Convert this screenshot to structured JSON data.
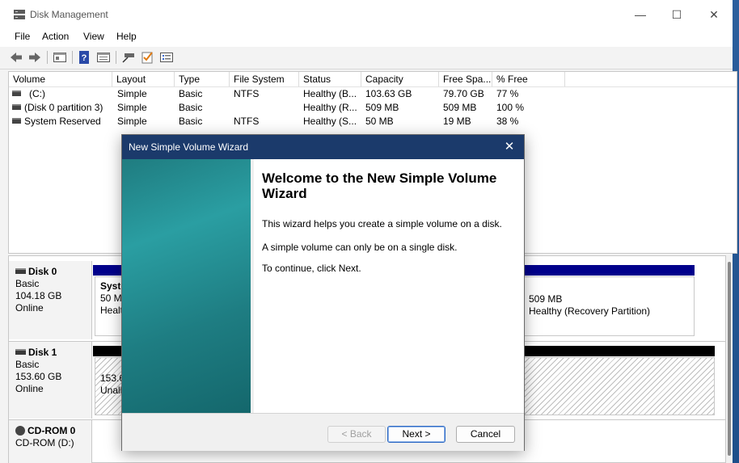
{
  "window": {
    "title": "Disk Management",
    "controls": {
      "minimize": "—",
      "maximize": "☐",
      "close": "✕"
    }
  },
  "menu": [
    "File",
    "Action",
    "View",
    "Help"
  ],
  "toolbar": {
    "icons": [
      "back-arrow-icon",
      "forward-arrow-icon",
      "console-tree-icon",
      "help-icon",
      "properties-icon",
      "connect-icon",
      "check-icon",
      "list-view-icon"
    ]
  },
  "volume_list": {
    "columns": [
      "Volume",
      "Layout",
      "Type",
      "File System",
      "Status",
      "Capacity",
      "Free Spa...",
      "% Free"
    ],
    "rows": [
      [
        "(C:)",
        "Simple",
        "Basic",
        "NTFS",
        "Healthy (B...",
        "103.63 GB",
        "79.70 GB",
        "77 %"
      ],
      [
        "(Disk 0 partition 3)",
        "Simple",
        "Basic",
        "",
        "Healthy (R...",
        "509 MB",
        "509 MB",
        "100 %"
      ],
      [
        "System Reserved",
        "Simple",
        "Basic",
        "NTFS",
        "Healthy (S...",
        "50 MB",
        "19 MB",
        "38 %"
      ]
    ]
  },
  "disks": [
    {
      "name": "Disk 0",
      "type": "Basic",
      "size": "104.18 GB",
      "state": "Online",
      "left_partition": {
        "name": "Syste",
        "size": "50 MB",
        "status": "Healt"
      },
      "right_partition": {
        "size": "509 MB",
        "status": "Healthy (Recovery Partition)"
      }
    },
    {
      "name": "Disk 1",
      "type": "Basic",
      "size": "153.60 GB",
      "state": "Online",
      "partition": {
        "size": "153.60",
        "status": "Unall"
      }
    },
    {
      "name": "CD-ROM 0",
      "type": "CD-ROM (D:)"
    }
  ],
  "colors": {
    "primary_bar": "#00008b",
    "unallocated_bar": "#000000",
    "dialog_title": "#1b3a6b"
  },
  "wizard": {
    "title": "New Simple Volume Wizard",
    "close": "✕",
    "heading": "Welcome to the New Simple Volume Wizard",
    "para1": "This wizard helps you create a simple volume on a disk.",
    "para2": "A simple volume can only be on a single disk.",
    "para3": "To continue, click Next.",
    "back": "< Back",
    "next": "Next >",
    "cancel": "Cancel"
  }
}
